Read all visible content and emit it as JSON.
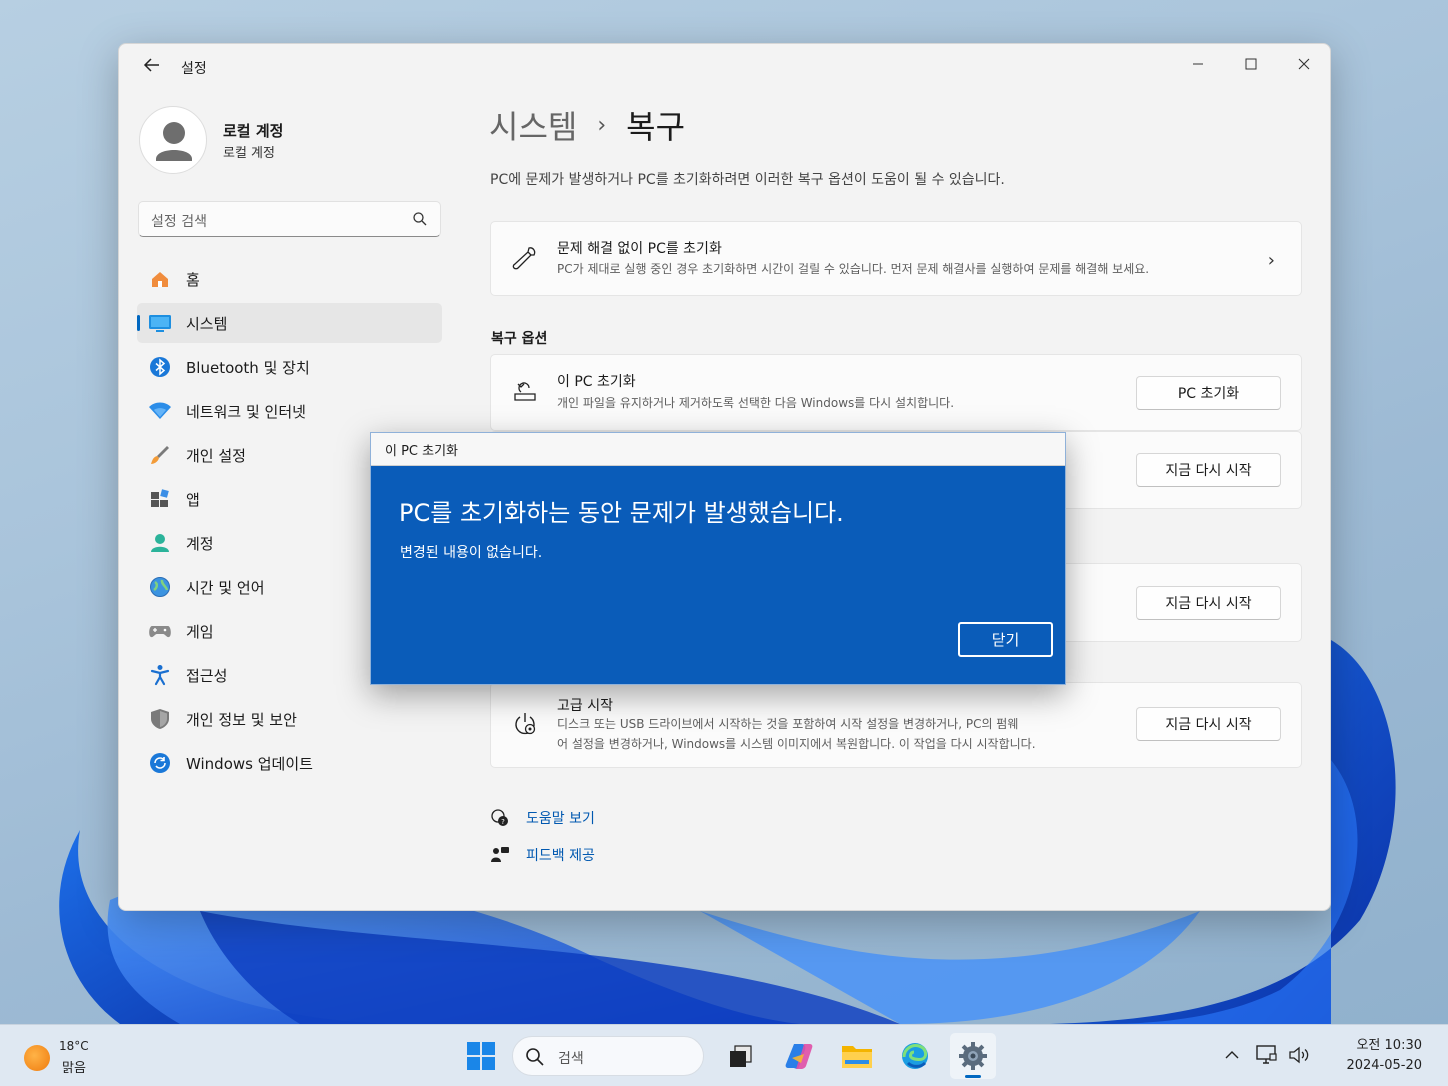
{
  "window": {
    "title": "설정",
    "controls": {
      "minimize": "—",
      "maximize": "☐",
      "close": "✕"
    }
  },
  "profile": {
    "name": "로컬 계정",
    "subtitle": "로컬 계정"
  },
  "search": {
    "placeholder": "설정 검색"
  },
  "nav": {
    "items": [
      {
        "label": "홈",
        "icon": "home-icon"
      },
      {
        "label": "시스템",
        "icon": "system-icon",
        "active": true
      },
      {
        "label": "Bluetooth 및 장치",
        "icon": "bluetooth-icon"
      },
      {
        "label": "네트워크 및 인터넷",
        "icon": "wifi-icon"
      },
      {
        "label": "개인 설정",
        "icon": "brush-icon"
      },
      {
        "label": "앱",
        "icon": "apps-icon"
      },
      {
        "label": "계정",
        "icon": "account-icon"
      },
      {
        "label": "시간 및 언어",
        "icon": "globe-icon"
      },
      {
        "label": "게임",
        "icon": "gamepad-icon"
      },
      {
        "label": "접근성",
        "icon": "accessibility-icon"
      },
      {
        "label": "개인 정보 및 보안",
        "icon": "shield-icon"
      },
      {
        "label": "Windows 업데이트",
        "icon": "update-icon"
      }
    ]
  },
  "main": {
    "breadcrumb": {
      "parent": "시스템",
      "separator": "›",
      "current": "복구"
    },
    "description": "PC에 문제가 발생하거나 PC를 초기화하려면 이러한 복구 옵션이 도움이 될 수 있습니다.",
    "troubleshoot_card": {
      "title": "문제 해결 없이 PC를 초기화",
      "subtitle": "PC가 제대로 실행 중인 경우 초기화하면 시간이 걸릴 수 있습니다. 먼저 문제 해결사를 실행하여 문제를 해결해 보세요.",
      "chevron": "›"
    },
    "section_title": "복구 옵션",
    "reset_card": {
      "title": "이 PC 초기화",
      "subtitle": "개인 파일을 유지하거나 제거하도록 선택한 다음 Windows를 다시 설치합니다.",
      "button": "PC 초기화"
    },
    "restart_button_2": "지금 다시 시작",
    "restart_button_3": "지금 다시 시작",
    "advanced_card": {
      "title": "고급 시작",
      "subtitle_line1": "디스크 또는 USB 드라이브에서 시작하는 것을 포함하여 시작 설정을 변경하거나, PC의 펌웨",
      "subtitle_line2": "어 설정을 변경하거나, Windows를 시스템 이미지에서 복원합니다. 이 작업을 다시 시작합니다.",
      "button": "지금 다시 시작"
    },
    "links": {
      "help": "도움말 보기",
      "feedback": "피드백 제공"
    }
  },
  "dialog": {
    "header": "이 PC 초기화",
    "title": "PC를 초기화하는 동안 문제가 발생했습니다.",
    "message": "변경된 내용이 없습니다.",
    "close_button": "닫기"
  },
  "taskbar": {
    "weather": {
      "temp": "18°C",
      "condition": "맑음"
    },
    "search_placeholder": "검색",
    "tray": {
      "chevron": "^"
    },
    "clock": {
      "time": "오전 10:30",
      "date": "2024-05-20"
    }
  },
  "colors": {
    "accent": "#0067c0",
    "dialog_bg": "#0a5cb9",
    "link": "#0058b0"
  }
}
